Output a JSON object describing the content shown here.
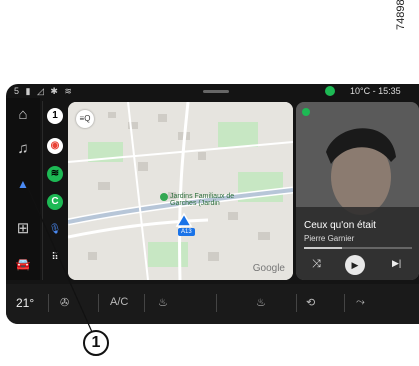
{
  "reference_number": "74898",
  "status_bar": {
    "left_icons": "5 ▮ ◿ ✱ ≋",
    "temperature": "10°C",
    "time": "15:35"
  },
  "sidebar": {
    "items": [
      {
        "icon": "home-icon",
        "glyph": "⌂"
      },
      {
        "icon": "music-note-icon",
        "glyph": "♫"
      },
      {
        "icon": "navigation-arrow-icon",
        "glyph": "▲"
      },
      {
        "icon": "app-grid-icon",
        "glyph": "⊞"
      },
      {
        "icon": "car-icon",
        "glyph": "🚘"
      }
    ]
  },
  "apps": [
    {
      "name": "notifications",
      "label": "1",
      "color": "#ffffff",
      "text_color": "#000000"
    },
    {
      "name": "google-maps",
      "label": "◉",
      "color": "#ffffff",
      "text_color": "#e94235"
    },
    {
      "name": "spotify",
      "label": "≋",
      "color": "#1db954",
      "text_color": "#000000"
    },
    {
      "name": "phone",
      "label": "C",
      "color": "#1db954",
      "text_color": "#ffffff"
    },
    {
      "name": "microphone",
      "label": "🎙",
      "color": "transparent",
      "text_color": "#4a8af4"
    },
    {
      "name": "app-launcher",
      "label": "⠿",
      "color": "transparent",
      "text_color": "#ffffff"
    }
  ],
  "map": {
    "poi_label": "Jardins Familiaux de Garches (Jardin",
    "road_label": "A13",
    "brand": "Google",
    "button_glyph": "≡Q"
  },
  "media": {
    "title": "Ceux qu'on était",
    "artist": "Pierre Garnier",
    "progress": 0.35,
    "shuffle_glyph": "⤨",
    "play_glyph": "▶",
    "next_glyph": "▶|"
  },
  "bottom_bar": {
    "temperature": "21°",
    "fan_glyph": "✇",
    "ac_label": "A/C",
    "seat_heat_glyph": "♨",
    "rear_heat_glyph": "♨",
    "recirc_glyph": "⟲",
    "airflow_glyph": "⤳"
  },
  "callout": {
    "label": "1"
  },
  "colors": {
    "accent_blue": "#1a73e8",
    "spotify_green": "#1db954",
    "screen_background": "#141414"
  }
}
